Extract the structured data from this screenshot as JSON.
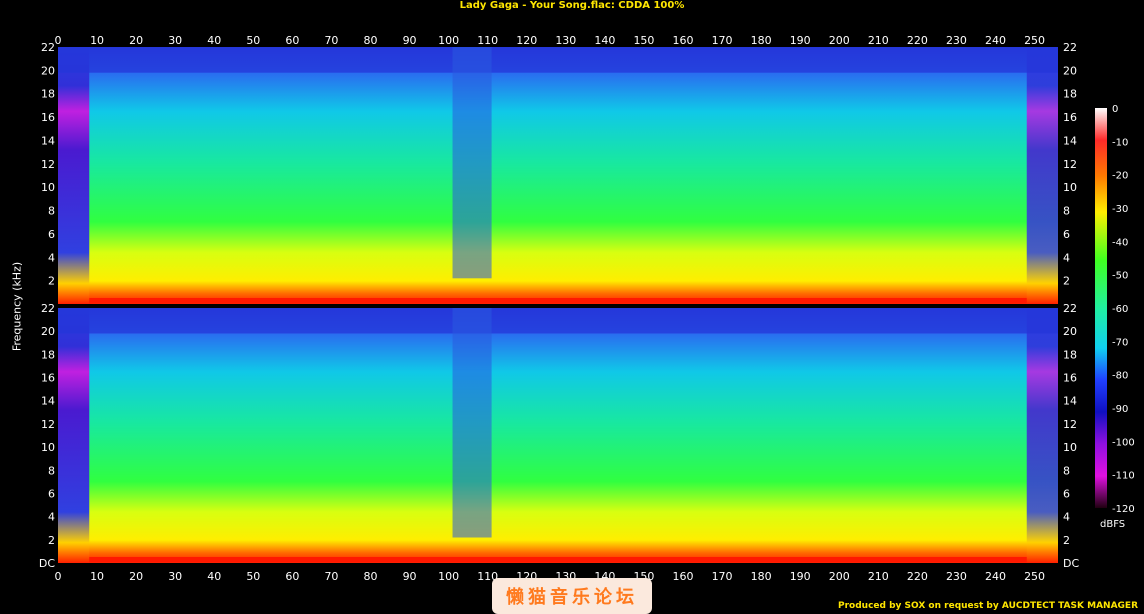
{
  "title": "Lady Gaga - Your Song.flac: CDDA 100%",
  "credit": "Produced by SOX on request by AUCDTECT TASK MANAGER",
  "watermark": "懒猫音乐论坛",
  "chart_data": {
    "type": "heatmap",
    "title": "Lady Gaga - Your Song.flac: CDDA 100%",
    "xlabel": "",
    "ylabel": "Frequency (kHz)",
    "x_ticks": [
      "0",
      "10",
      "20",
      "30",
      "40",
      "50",
      "60",
      "70",
      "80",
      "90",
      "100",
      "110",
      "120",
      "130",
      "140",
      "150",
      "160",
      "170",
      "180",
      "190",
      "200",
      "210",
      "220",
      "230",
      "240",
      "250"
    ],
    "xlim": [
      0,
      256
    ],
    "y_ticks": [
      "DC",
      "2",
      "4",
      "6",
      "8",
      "10",
      "12",
      "14",
      "16",
      "18",
      "20",
      "22"
    ],
    "ylim": [
      0,
      22
    ],
    "channels": 2,
    "colorbar": {
      "label": "dBFS",
      "ticks": [
        "0",
        "-10",
        "-20",
        "-30",
        "-40",
        "-50",
        "-60",
        "-70",
        "-80",
        "-90",
        "-100",
        "-110",
        "-120"
      ],
      "range": [
        -120,
        0
      ]
    },
    "colors": {
      "background": "#000000",
      "title": "#ffe600",
      "quiet": "#1a2fd8",
      "loud": "#ff2a00"
    }
  }
}
